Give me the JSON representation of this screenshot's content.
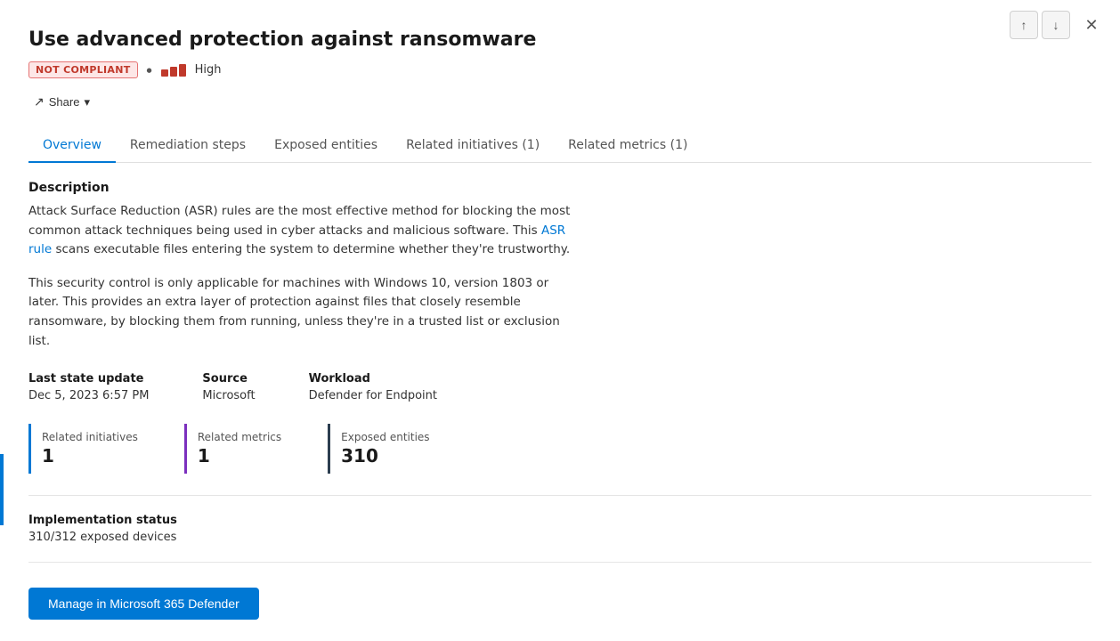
{
  "header": {
    "title": "Use advanced protection against ransomware"
  },
  "status": {
    "badge": "NOT COMPLIANT",
    "severity_label": "High"
  },
  "share": {
    "label": "Share",
    "chevron": "▾"
  },
  "tabs": [
    {
      "id": "overview",
      "label": "Overview",
      "active": true
    },
    {
      "id": "remediation",
      "label": "Remediation steps",
      "active": false
    },
    {
      "id": "exposed",
      "label": "Exposed entities",
      "active": false
    },
    {
      "id": "initiatives",
      "label": "Related initiatives (1)",
      "active": false
    },
    {
      "id": "metrics",
      "label": "Related metrics (1)",
      "active": false
    }
  ],
  "description": {
    "section_title": "Description",
    "para1_part1": "Attack Surface Reduction (ASR) rules are the most effective method for blocking the most common attack techniques being used in cyber attacks and malicious software. This ",
    "link_text": "ASR rule",
    "para1_part2": " scans executable files entering the system to determine whether they're trustworthy.",
    "para2": "This security control is only applicable for machines with Windows 10, version 1803 or later. This provides an extra layer of protection against files that closely resemble ransomware, by blocking them from running, unless they're in a trusted list or exclusion list."
  },
  "meta": {
    "last_state_label": "Last state update",
    "last_state_value": "Dec 5, 2023 6:57 PM",
    "source_label": "Source",
    "source_value": "Microsoft",
    "workload_label": "Workload",
    "workload_value": "Defender for Endpoint"
  },
  "stats": [
    {
      "label": "Related initiatives",
      "value": "1",
      "color": "blue"
    },
    {
      "label": "Related metrics",
      "value": "1",
      "color": "purple"
    },
    {
      "label": "Exposed entities",
      "value": "310",
      "color": "dark"
    }
  ],
  "implementation": {
    "label": "Implementation status",
    "value": "310/312 exposed devices"
  },
  "manage_btn": "Manage in Microsoft 365 Defender",
  "nav_icons": {
    "up": "↑",
    "down": "↓",
    "close": "✕"
  }
}
